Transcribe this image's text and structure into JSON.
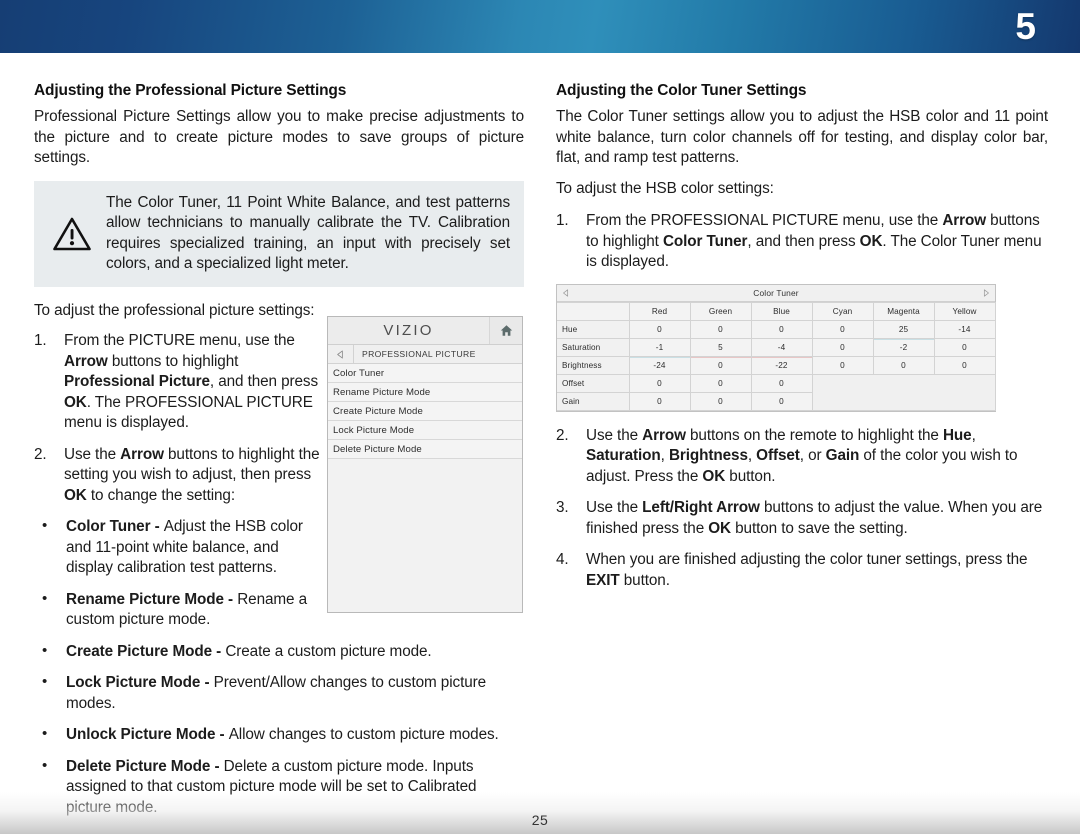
{
  "header": {
    "chapter_number": "5"
  },
  "footer": {
    "page_number": "25"
  },
  "left_column": {
    "section_title": "Adjusting the Professional Picture Settings",
    "intro_paragraph": "Professional Picture Settings allow you to make precise adjustments to the picture and to create picture modes to save groups of picture settings.",
    "note": {
      "icon": "warning-triangle-icon",
      "text": "The Color Tuner, 11 Point White Balance, and test patterns allow technicians to manually calibrate the TV. Calibration requires specialized training, an input with precisely set colors, and a specialized light meter.",
      "background_color": "#e8ecee"
    },
    "lead_in": "To adjust the professional picture settings:",
    "steps": [
      {
        "number": "1.",
        "parts": [
          {
            "t": "From the PICTURE menu, use the ",
            "b": false
          },
          {
            "t": "Arrow",
            "b": true
          },
          {
            "t": " buttons to highlight ",
            "b": false
          },
          {
            "t": "Professional Picture",
            "b": true
          },
          {
            "t": ", and then press ",
            "b": false
          },
          {
            "t": "OK",
            "b": true
          },
          {
            "t": ". The PROFESSIONAL PICTURE menu is displayed.",
            "b": false
          }
        ]
      },
      {
        "number": "2.",
        "parts": [
          {
            "t": "Use the ",
            "b": false
          },
          {
            "t": "Arrow",
            "b": true
          },
          {
            "t": " buttons to highlight the setting you wish to adjust, then press ",
            "b": false
          },
          {
            "t": "OK",
            "b": true
          },
          {
            "t": " to change the setting:",
            "b": false
          }
        ]
      }
    ],
    "bullets": [
      {
        "bullet": "•",
        "narrow": true,
        "parts": [
          {
            "t": "Color Tuner - ",
            "b": true
          },
          {
            "t": "Adjust the HSB color and 11-point white balance, and display calibration test patterns.",
            "b": false
          }
        ]
      },
      {
        "bullet": "•",
        "narrow": true,
        "parts": [
          {
            "t": "Rename Picture Mode - ",
            "b": true
          },
          {
            "t": "Rename a custom picture mode.",
            "b": false
          }
        ]
      },
      {
        "bullet": "•",
        "narrow": false,
        "parts": [
          {
            "t": "Create Picture Mode - ",
            "b": true
          },
          {
            "t": "Create a custom picture mode.",
            "b": false
          }
        ]
      },
      {
        "bullet": "•",
        "narrow": false,
        "parts": [
          {
            "t": "Lock Picture Mode - ",
            "b": true
          },
          {
            "t": "Prevent/Allow changes to custom picture modes.",
            "b": false
          }
        ]
      },
      {
        "bullet": "•",
        "narrow": false,
        "parts": [
          {
            "t": "Unlock Picture Mode - ",
            "b": true
          },
          {
            "t": "Allow changes to custom picture modes.",
            "b": false
          }
        ]
      },
      {
        "bullet": "•",
        "narrow": false,
        "parts": [
          {
            "t": "Delete Picture Mode - ",
            "b": true
          },
          {
            "t": "Delete a custom picture mode. Inputs assigned to that custom picture mode will be set to Calibrated picture mode.",
            "b": false
          }
        ]
      }
    ]
  },
  "tv_menu": {
    "brand": "VIZIO",
    "home_icon": "home-icon",
    "back_icon": "back-arrow-icon",
    "breadcrumb": "PROFESSIONAL PICTURE",
    "items": [
      {
        "label": "Color Tuner"
      },
      {
        "label": "Rename Picture Mode"
      },
      {
        "label": "Create Picture Mode"
      },
      {
        "label": "Lock Picture Mode"
      },
      {
        "label": "Delete Picture Mode"
      }
    ]
  },
  "right_column": {
    "section_title": "Adjusting the Color Tuner Settings",
    "intro_paragraph": "The Color Tuner settings allow you to adjust the HSB color and 11 point white balance, turn color channels off for testing, and display color bar, flat, and ramp test patterns.",
    "lead_in": "To adjust the HSB color settings:",
    "step1": {
      "number": "1.",
      "parts": [
        {
          "t": "From the PROFESSIONAL PICTURE menu, use the ",
          "b": false
        },
        {
          "t": "Arrow",
          "b": true
        },
        {
          "t": " buttons to highlight ",
          "b": false
        },
        {
          "t": "Color Tuner",
          "b": true
        },
        {
          "t": ", and then press ",
          "b": false
        },
        {
          "t": "OK",
          "b": true
        },
        {
          "t": ". The Color Tuner menu is displayed.",
          "b": false
        }
      ]
    },
    "steps_after": [
      {
        "number": "2.",
        "parts": [
          {
            "t": "Use the ",
            "b": false
          },
          {
            "t": "Arrow",
            "b": true
          },
          {
            "t": " buttons on the remote to highlight the ",
            "b": false
          },
          {
            "t": "Hue",
            "b": true
          },
          {
            "t": ", ",
            "b": false
          },
          {
            "t": "Saturation",
            "b": true
          },
          {
            "t": ", ",
            "b": false
          },
          {
            "t": "Brightness",
            "b": true
          },
          {
            "t": ", ",
            "b": false
          },
          {
            "t": "Offset",
            "b": true
          },
          {
            "t": ", or ",
            "b": false
          },
          {
            "t": "Gain",
            "b": true
          },
          {
            "t": " of the color you wish to adjust. Press the ",
            "b": false
          },
          {
            "t": "OK",
            "b": true
          },
          {
            "t": "  button.",
            "b": false
          }
        ]
      },
      {
        "number": "3.",
        "parts": [
          {
            "t": "Use the ",
            "b": false
          },
          {
            "t": "Left/Right Arrow",
            "b": true
          },
          {
            "t": " buttons to adjust the value. When you are finished press the ",
            "b": false
          },
          {
            "t": "OK",
            "b": true
          },
          {
            "t": " button to save the setting.",
            "b": false
          }
        ]
      },
      {
        "number": "4.",
        "parts": [
          {
            "t": "When you are finished adjusting the color tuner settings, press the ",
            "b": false
          },
          {
            "t": "EXIT",
            "b": true
          },
          {
            "t": " button.",
            "b": false
          }
        ]
      }
    ]
  },
  "color_tuner_table": {
    "title": "Color Tuner",
    "left_arrow_icon": "left-arrow-icon",
    "right_arrow_icon": "right-arrow-icon",
    "columns": [
      "Red",
      "Green",
      "Blue",
      "Cyan",
      "Magenta",
      "Yellow"
    ],
    "rows": [
      {
        "label": "Hue",
        "values": [
          "0",
          "0",
          "0",
          "0",
          "25",
          "-14"
        ]
      },
      {
        "label": "Saturation",
        "values": [
          "-1",
          "5",
          "-4",
          "0",
          "-2",
          "0"
        ]
      },
      {
        "label": "Brightness",
        "values": [
          "-24",
          "0",
          "-22",
          "0",
          "0",
          "0"
        ]
      },
      {
        "label": "Offset",
        "values": [
          "0",
          "0",
          "0",
          "",
          "",
          ""
        ]
      },
      {
        "label": "Gain",
        "values": [
          "0",
          "0",
          "0",
          "",
          "",
          ""
        ]
      }
    ]
  }
}
